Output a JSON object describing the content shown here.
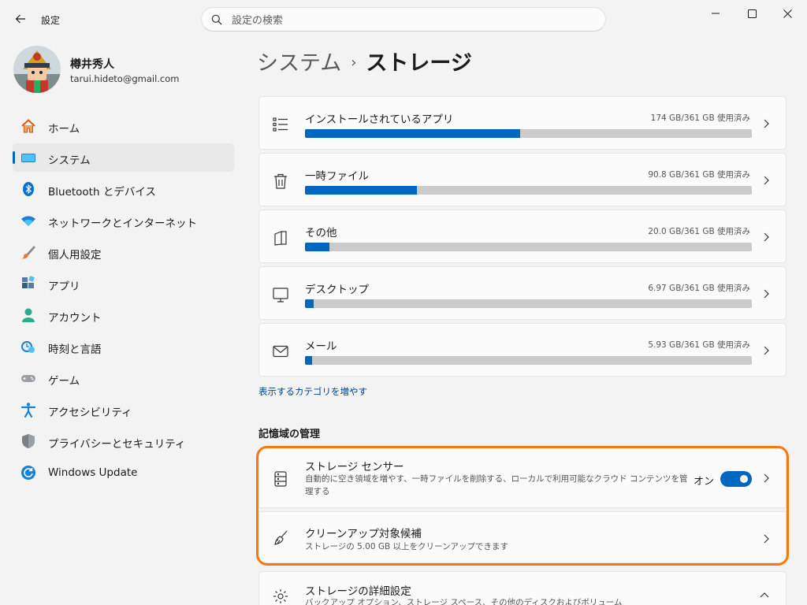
{
  "app": {
    "title": "設定",
    "search_placeholder": "設定の検索"
  },
  "user": {
    "name": "樽井秀人",
    "email": "tarui.hideto@gmail.com"
  },
  "nav": [
    {
      "label": "ホーム",
      "icon": "home-icon",
      "active": false
    },
    {
      "label": "システム",
      "icon": "system-icon",
      "active": true
    },
    {
      "label": "Bluetooth とデバイス",
      "icon": "bluetooth-icon",
      "active": false
    },
    {
      "label": "ネットワークとインターネット",
      "icon": "wifi-icon",
      "active": false
    },
    {
      "label": "個人用設定",
      "icon": "brush-icon",
      "active": false
    },
    {
      "label": "アプリ",
      "icon": "apps-icon",
      "active": false
    },
    {
      "label": "アカウント",
      "icon": "account-icon",
      "active": false
    },
    {
      "label": "時刻と言語",
      "icon": "time-language-icon",
      "active": false
    },
    {
      "label": "ゲーム",
      "icon": "game-controller-icon",
      "active": false
    },
    {
      "label": "アクセシビリティ",
      "icon": "accessibility-icon",
      "active": false
    },
    {
      "label": "プライバシーとセキュリティ",
      "icon": "shield-icon",
      "active": false
    },
    {
      "label": "Windows Update",
      "icon": "update-icon",
      "active": false
    }
  ],
  "breadcrumb": {
    "parent": "システム",
    "separator": "›",
    "current": "ストレージ"
  },
  "storage_categories": [
    {
      "title": "インストールされているアプリ",
      "usage": "174 GB/361 GB 使用済み",
      "fraction": 0.482,
      "icon": "apps-list-icon"
    },
    {
      "title": "一時ファイル",
      "usage": "90.8 GB/361 GB 使用済み",
      "fraction": 0.251,
      "icon": "trash-icon"
    },
    {
      "title": "その他",
      "usage": "20.0 GB/361 GB 使用済み",
      "fraction": 0.055,
      "icon": "other-files-icon"
    },
    {
      "title": "デスクトップ",
      "usage": "6.97 GB/361 GB 使用済み",
      "fraction": 0.019,
      "icon": "desktop-icon"
    },
    {
      "title": "メール",
      "usage": "5.93 GB/361 GB 使用済み",
      "fraction": 0.016,
      "icon": "mail-icon"
    }
  ],
  "more_categories_link": "表示するカテゴリを増やす",
  "management": {
    "section_title": "記憶域の管理",
    "storage_sense": {
      "title": "ストレージ センサー",
      "description_line1": "自動的に空き領域を増やす、一時ファイルを削除する、ローカルで利用可能なクラウド コンテンツを管",
      "description_line2": "理する",
      "toggle_label": "オン",
      "toggle_on": true
    },
    "cleanup": {
      "title": "クリーンアップ対象候補",
      "description": "ストレージの 5.00 GB 以上をクリーンアップできます"
    },
    "advanced": {
      "title": "ストレージの詳細設定",
      "description": "バックアップ オプション、ストレージ スペース、その他のディスクおよびボリューム"
    }
  },
  "colors": {
    "accent": "#0067c0",
    "highlight": "#f47a0d"
  }
}
